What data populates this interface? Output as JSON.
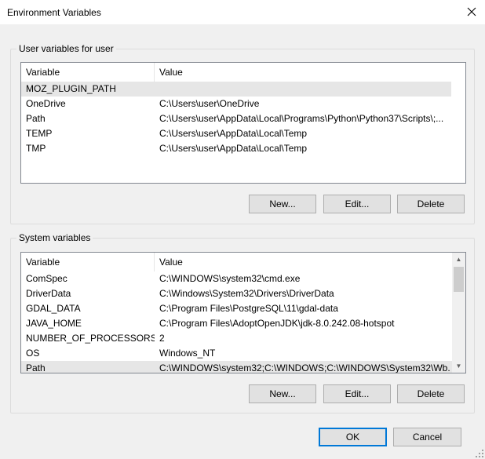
{
  "window": {
    "title": "Environment Variables",
    "close_icon": "close-icon"
  },
  "user_group": {
    "label": "User variables for user",
    "columns": [
      "Variable",
      "Value"
    ],
    "rows": [
      {
        "variable": "MOZ_PLUGIN_PATH",
        "value": ""
      },
      {
        "variable": "OneDrive",
        "value": "C:\\Users\\user\\OneDrive"
      },
      {
        "variable": "Path",
        "value": "C:\\Users\\user\\AppData\\Local\\Programs\\Python\\Python37\\Scripts\\;..."
      },
      {
        "variable": "TEMP",
        "value": "C:\\Users\\user\\AppData\\Local\\Temp"
      },
      {
        "variable": "TMP",
        "value": "C:\\Users\\user\\AppData\\Local\\Temp"
      }
    ],
    "selected_row": 0,
    "buttons": {
      "new": "New...",
      "edit": "Edit...",
      "delete": "Delete"
    }
  },
  "system_group": {
    "label": "System variables",
    "columns": [
      "Variable",
      "Value"
    ],
    "rows": [
      {
        "variable": "ComSpec",
        "value": "C:\\WINDOWS\\system32\\cmd.exe"
      },
      {
        "variable": "DriverData",
        "value": "C:\\Windows\\System32\\Drivers\\DriverData"
      },
      {
        "variable": "GDAL_DATA",
        "value": "C:\\Program Files\\PostgreSQL\\11\\gdal-data"
      },
      {
        "variable": "JAVA_HOME",
        "value": "C:\\Program Files\\AdoptOpenJDK\\jdk-8.0.242.08-hotspot"
      },
      {
        "variable": "NUMBER_OF_PROCESSORS",
        "value": "2"
      },
      {
        "variable": "OS",
        "value": "Windows_NT"
      },
      {
        "variable": "Path",
        "value": "C:\\WINDOWS\\system32;C:\\WINDOWS;C:\\WINDOWS\\System32\\Wb..."
      }
    ],
    "selected_row": 6,
    "scroll_fraction": 0.0,
    "buttons": {
      "new": "New...",
      "edit": "Edit...",
      "delete": "Delete"
    }
  },
  "footer": {
    "ok": "OK",
    "cancel": "Cancel"
  },
  "colors": {
    "accent": "#0078d7",
    "selection": "#e6e6e6",
    "button": "#e1e1e1"
  }
}
